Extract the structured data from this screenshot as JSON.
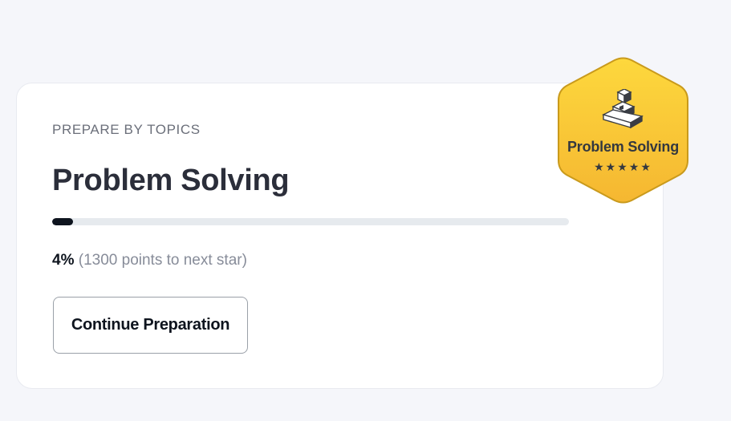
{
  "card": {
    "eyebrow": "PREPARE BY TOPICS",
    "title": "Problem Solving",
    "progress_value": 0.04,
    "progress_percent": "4%",
    "points_text": "(1300 points to next star)",
    "button_label": "Continue Preparation"
  },
  "badge": {
    "label": "Problem Solving",
    "stars": "★★★★★",
    "icon": "blocks-icon",
    "color_top": "#fdd83d",
    "color_bottom": "#f5b731",
    "border_color": "#c99a1c"
  },
  "colors": {
    "page_bg": "#f5f6fa",
    "card_bg": "#ffffff",
    "progress_fill": "#0e141e",
    "progress_track": "#e6eaee"
  }
}
